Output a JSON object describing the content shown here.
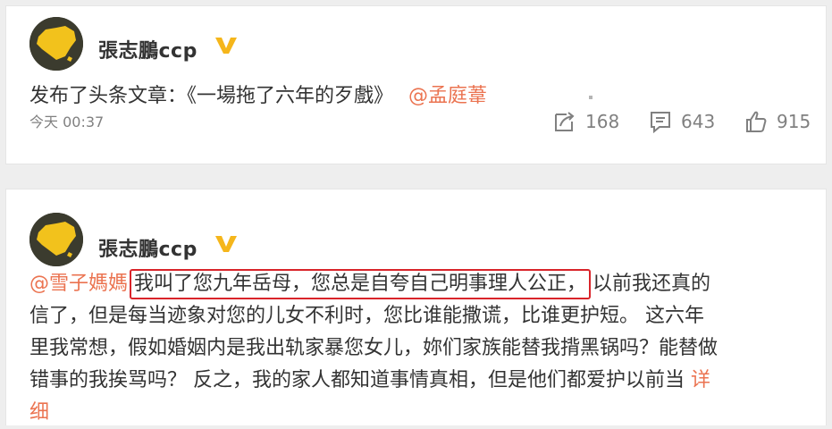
{
  "post1": {
    "author": "張志鵬ccp",
    "text_prefix": "发布了头条文章：《一場拖了六年的歹戲》",
    "mention": "@孟庭葦",
    "timestamp": "今天 00:37",
    "repost_count": "168",
    "comment_count": "643",
    "like_count": "915"
  },
  "post2": {
    "author": "張志鵬ccp",
    "mention": "@雪子媽媽",
    "highlighted": "我叫了您九年岳母，您总是自夸自己明事理人公正，",
    "line1_rest": "以前我还真的",
    "line2": "信了，但是每当迹象对您的儿女不利时，您比谁能撒谎，比谁更护短。 这六年",
    "line3": "里我常想，假如婚姻内是我出轨家暴您女儿，妳们家族能替我揹黑锅吗？能替做",
    "line4": "错事的我挨骂吗？ 反之，我的家人都知道事情真相，但是他们都爱护以前当",
    "more_label_1": "详",
    "more_label_2": "细"
  },
  "icons": {
    "verified": "verified-v-badge-icon",
    "repost": "repost-icon",
    "comment": "comment-icon",
    "like": "thumbs-up-icon"
  },
  "colors": {
    "link": "#eb7350",
    "verified_badge": "#f5b61b",
    "highlight_border": "#d9242a",
    "meta_gray": "#808080"
  }
}
